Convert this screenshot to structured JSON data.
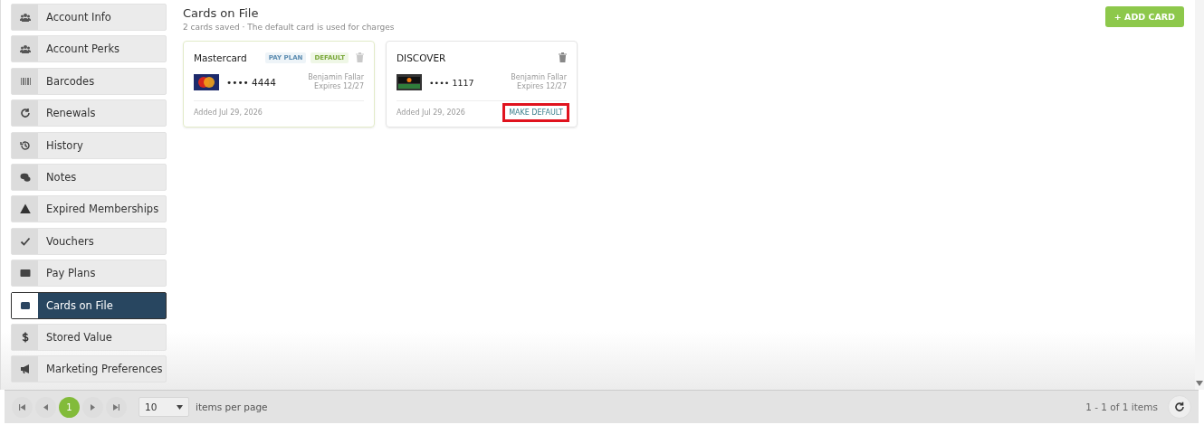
{
  "sidebar": {
    "items": [
      {
        "label": "Account Info",
        "selected": false
      },
      {
        "label": "Account Perks",
        "selected": false
      },
      {
        "label": "Barcodes",
        "selected": false
      },
      {
        "label": "Renewals",
        "selected": false
      },
      {
        "label": "History",
        "selected": false
      },
      {
        "label": "Notes",
        "selected": false
      },
      {
        "label": "Expired Memberships",
        "selected": false
      },
      {
        "label": "Vouchers",
        "selected": false
      },
      {
        "label": "Pay Plans",
        "selected": false
      },
      {
        "label": "Cards on File",
        "selected": true
      },
      {
        "label": "Stored Value",
        "selected": false
      },
      {
        "label": "Marketing Preferences",
        "selected": false
      }
    ]
  },
  "header": {
    "title": "Cards on File",
    "subtitle": "2 cards saved · The default card is used for charges",
    "add_button": "+ ADD CARD"
  },
  "cards": [
    {
      "kind": "mastercard",
      "brand": "Mastercard",
      "default": true,
      "tags": [
        "PAY PLAN",
        "DEFAULT"
      ],
      "number": "•••• 4444",
      "holder": "Benjamin Fallar",
      "expires": "Expires 12/27",
      "added": "Added Jul 29, 2026"
    },
    {
      "kind": "discover",
      "brand": "DISCOVER",
      "default": false,
      "number": "•••• 1117",
      "holder": "Benjamin Fallar",
      "expires": "Expires 12/27",
      "added": "Added Jul 29, 2026",
      "action": "MAKE DEFAULT",
      "action_highlighted": true
    }
  ],
  "pager": {
    "pages": [
      {
        "label": "1",
        "selected": true
      }
    ],
    "page_size": "10",
    "page_size_label": "items per page",
    "summary": "1 - 1 of 1 items"
  }
}
